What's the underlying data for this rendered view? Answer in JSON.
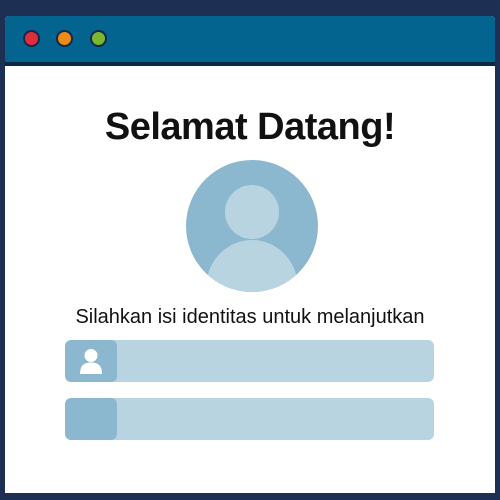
{
  "window": {
    "controls": [
      {
        "name": "close",
        "color": "#e12d3a"
      },
      {
        "name": "minimize",
        "color": "#ef8a17"
      },
      {
        "name": "maximize",
        "color": "#7cb82f"
      }
    ]
  },
  "main": {
    "title": "Selamat Datang!",
    "prompt": "Silahkan isi identitas untuk melanjutkan"
  },
  "fields": [
    {
      "icon": "user-icon",
      "value": ""
    },
    {
      "icon": "",
      "value": ""
    }
  ],
  "colors": {
    "titlebar": "#02648f",
    "background": "#1e2f54",
    "avatar_circle": "#8bb8cf",
    "avatar_figure": "#b8d4e1",
    "field_bg": "#b8d4e1"
  }
}
